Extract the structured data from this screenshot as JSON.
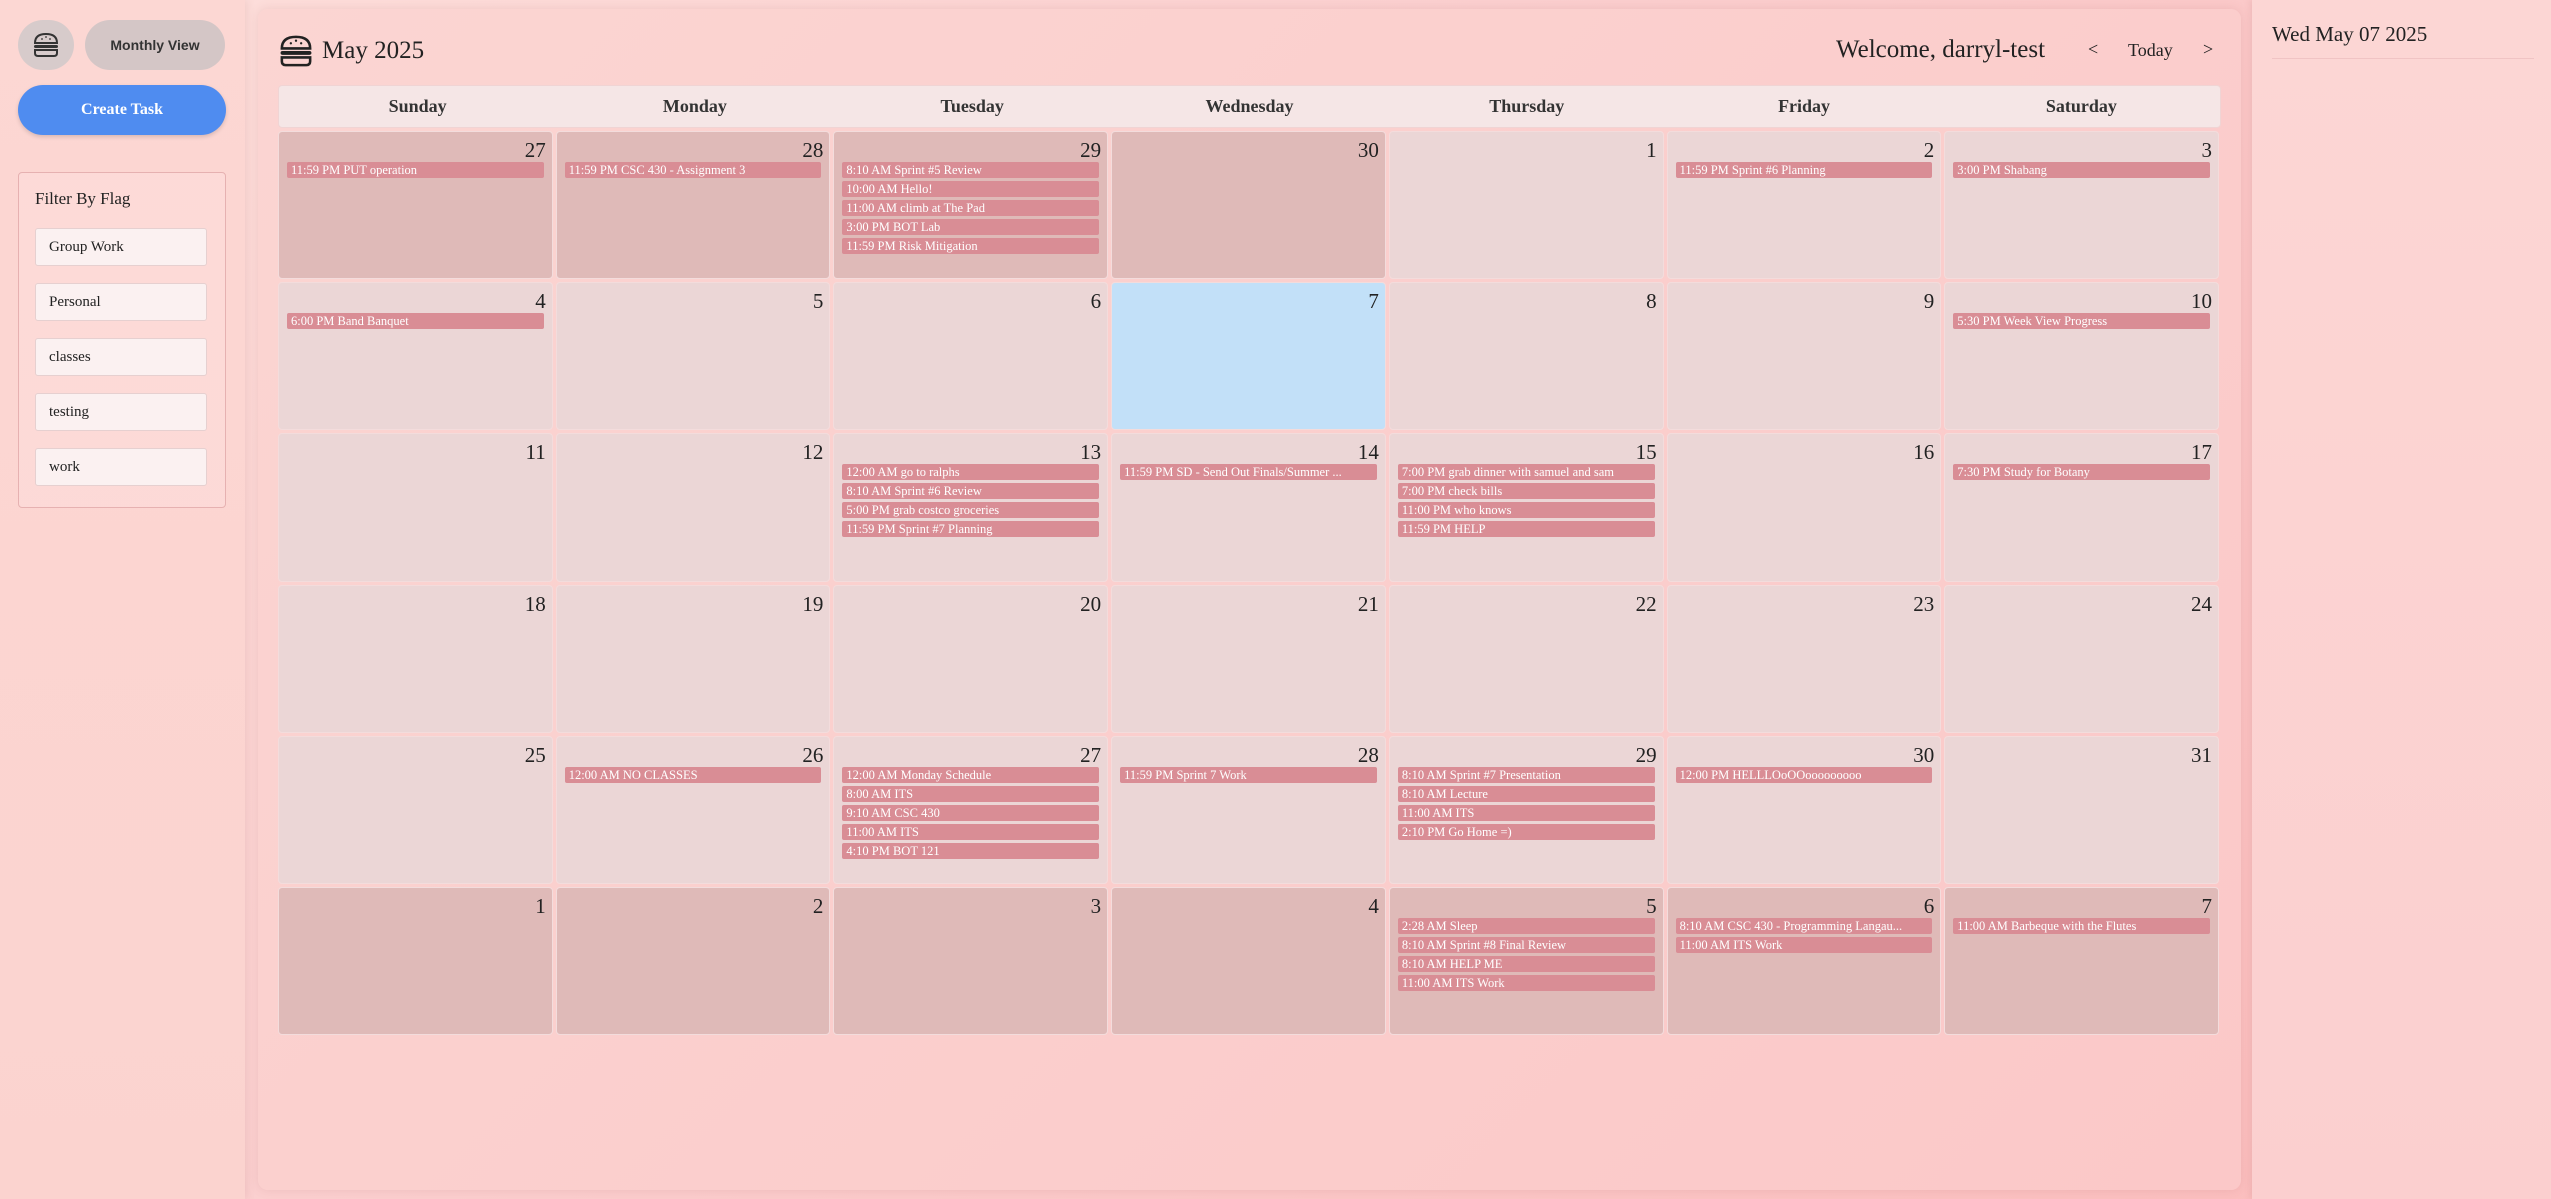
{
  "sidebar": {
    "monthly_view_label": "Monthly View",
    "create_task_label": "Create Task",
    "filter_title": "Filter By Flag",
    "filters": [
      "Group Work",
      "Personal",
      "classes",
      "testing",
      "work"
    ]
  },
  "header": {
    "title": "May 2025",
    "welcome": "Welcome, darryl-test",
    "prev": "<",
    "today": "Today",
    "next": ">"
  },
  "weekdays": [
    "Sunday",
    "Monday",
    "Tuesday",
    "Wednesday",
    "Thursday",
    "Friday",
    "Saturday"
  ],
  "weeks": [
    [
      {
        "day": "27",
        "other": true,
        "events": [
          "11:59 PM PUT operation"
        ]
      },
      {
        "day": "28",
        "other": true,
        "events": [
          "11:59 PM CSC 430 - Assignment 3"
        ]
      },
      {
        "day": "29",
        "other": true,
        "events": [
          "8:10 AM Sprint #5 Review",
          "10:00 AM Hello!",
          "11:00 AM climb at The Pad",
          "3:00 PM BOT Lab",
          "11:59 PM Risk Mitigation"
        ]
      },
      {
        "day": "30",
        "other": true,
        "events": []
      },
      {
        "day": "1",
        "events": []
      },
      {
        "day": "2",
        "events": [
          "11:59 PM Sprint #6 Planning"
        ]
      },
      {
        "day": "3",
        "events": [
          "3:00 PM Shabang"
        ]
      }
    ],
    [
      {
        "day": "4",
        "events": [
          "6:00 PM Band Banquet"
        ]
      },
      {
        "day": "5",
        "events": []
      },
      {
        "day": "6",
        "events": []
      },
      {
        "day": "7",
        "today": true,
        "events": []
      },
      {
        "day": "8",
        "events": []
      },
      {
        "day": "9",
        "events": []
      },
      {
        "day": "10",
        "events": [
          "5:30 PM Week View Progress"
        ]
      }
    ],
    [
      {
        "day": "11",
        "events": []
      },
      {
        "day": "12",
        "events": []
      },
      {
        "day": "13",
        "events": [
          "12:00 AM go to ralphs",
          "8:10 AM Sprint #6 Review",
          "5:00 PM grab costco groceries",
          "11:59 PM Sprint #7 Planning"
        ]
      },
      {
        "day": "14",
        "events": [
          "11:59 PM SD - Send Out Finals/Summer ..."
        ]
      },
      {
        "day": "15",
        "events": [
          "7:00 PM grab dinner with samuel and sam",
          "7:00 PM check bills",
          "11:00 PM who knows",
          "11:59 PM HELP"
        ]
      },
      {
        "day": "16",
        "events": []
      },
      {
        "day": "17",
        "events": [
          "7:30 PM Study for Botany"
        ]
      }
    ],
    [
      {
        "day": "18",
        "events": []
      },
      {
        "day": "19",
        "events": []
      },
      {
        "day": "20",
        "events": []
      },
      {
        "day": "21",
        "events": []
      },
      {
        "day": "22",
        "events": []
      },
      {
        "day": "23",
        "events": []
      },
      {
        "day": "24",
        "events": []
      }
    ],
    [
      {
        "day": "25",
        "events": []
      },
      {
        "day": "26",
        "events": [
          "12:00 AM NO CLASSES"
        ]
      },
      {
        "day": "27",
        "events": [
          "12:00 AM Monday Schedule",
          "8:00 AM ITS",
          "9:10 AM CSC 430",
          "11:00 AM ITS",
          "4:10 PM BOT 121"
        ]
      },
      {
        "day": "28",
        "events": [
          "11:59 PM Sprint 7 Work"
        ]
      },
      {
        "day": "29",
        "events": [
          "8:10 AM Sprint #7 Presentation",
          "8:10 AM Lecture",
          "11:00 AM ITS",
          "2:10 PM Go Home =)"
        ]
      },
      {
        "day": "30",
        "events": [
          "12:00 PM HELLLOoOOooooooooo"
        ]
      },
      {
        "day": "31",
        "events": []
      }
    ],
    [
      {
        "day": "1",
        "other": true,
        "events": []
      },
      {
        "day": "2",
        "other": true,
        "events": []
      },
      {
        "day": "3",
        "other": true,
        "events": []
      },
      {
        "day": "4",
        "other": true,
        "events": []
      },
      {
        "day": "5",
        "other": true,
        "events": [
          "2:28 AM Sleep",
          "8:10 AM Sprint #8 Final Review",
          "8:10 AM HELP ME",
          "11:00 AM ITS Work"
        ]
      },
      {
        "day": "6",
        "other": true,
        "events": [
          "8:10 AM CSC 430 - Programming Langau...",
          "11:00 AM ITS Work"
        ]
      },
      {
        "day": "7",
        "other": true,
        "events": [
          "11:00 AM Barbeque with the Flutes"
        ]
      }
    ]
  ],
  "right_panel": {
    "selected_date": "Wed May 07 2025"
  },
  "colors": {
    "event": "#d98d95",
    "today": "#c2e0f8",
    "create_button": "#4f8cf0"
  },
  "icons": {
    "menu": "burger-icon",
    "title": "burger-icon"
  }
}
